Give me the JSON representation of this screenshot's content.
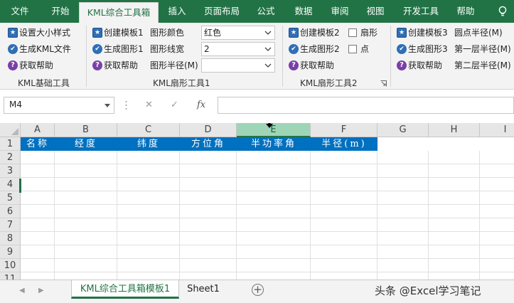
{
  "menu": {
    "tabs": [
      "文件",
      "开始",
      "KML综合工具箱",
      "插入",
      "页面布局",
      "公式",
      "数据",
      "审阅",
      "视图",
      "开发工具",
      "帮助"
    ],
    "active": "KML综合工具箱"
  },
  "ribbon": {
    "group1": {
      "label": "KML基础工具",
      "buttons": [
        "设置大小样式",
        "生成KML文件",
        "获取帮助"
      ]
    },
    "group2": {
      "label": "KML扇形工具1",
      "buttons": [
        "创建模板1",
        "生成图形1",
        "获取帮助"
      ],
      "field_labels": [
        "图形颜色",
        "图形线宽",
        "图形半径(M)"
      ],
      "field_values": [
        "红色",
        "2",
        ""
      ]
    },
    "group3": {
      "label": "KML扇形工具2",
      "buttons": [
        "创建模板2",
        "生成图形2",
        "获取帮助"
      ],
      "checkboxes": [
        "扇形",
        "点"
      ]
    },
    "group4": {
      "buttons": [
        "创建模板3",
        "生成图形3",
        "获取帮助"
      ],
      "field_labels": [
        "圆点半径(M)",
        "第一层半径(M)",
        "第二层半径(M)"
      ]
    }
  },
  "formula_bar": {
    "name_box": "M4",
    "fx": "fx",
    "cancel": "✕",
    "enter": "✓",
    "value": ""
  },
  "grid": {
    "columns": [
      "A",
      "B",
      "C",
      "D",
      "E",
      "F",
      "G",
      "H",
      "I"
    ],
    "selected_column": "E",
    "rows": [
      "1",
      "2",
      "3",
      "4",
      "5",
      "6",
      "7",
      "8",
      "9",
      "10",
      "11"
    ],
    "active_row": "4",
    "header_row": [
      "名称",
      "经度",
      "纬度",
      "方位角",
      "半功率角",
      "半径(m)"
    ]
  },
  "sheets": {
    "tabs": [
      "KML综合工具箱模板1",
      "Sheet1"
    ],
    "active": "KML综合工具箱模板1",
    "add": "+"
  },
  "watermark": "头条 @Excel学习笔记",
  "colors": {
    "ribbon_green": "#217346",
    "header_blue": "#0070c0",
    "selected_col": "#9fd5b7"
  }
}
